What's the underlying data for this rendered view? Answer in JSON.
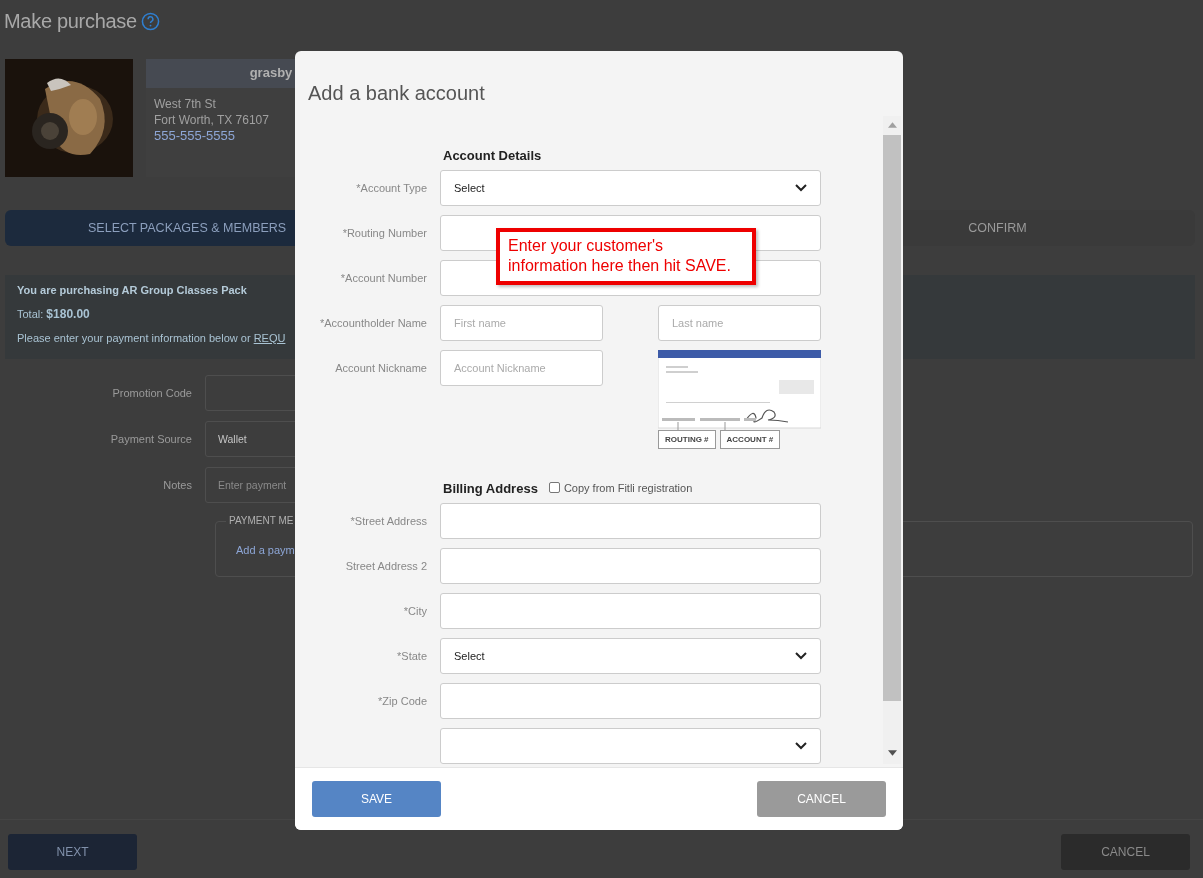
{
  "page": {
    "title": "Make purchase",
    "gym": {
      "name": "grasby",
      "address_line_1": "West 7th St",
      "address_line_2": "Fort Worth, TX 76107",
      "phone": "555-555-5555"
    },
    "steps": [
      {
        "label": "SELECT PACKAGES & MEMBERS",
        "selected": true
      },
      {
        "label": "CONFIRM",
        "selected": false
      }
    ],
    "summary": {
      "message": "You are purchasing AR Group Classes Pack",
      "total_label": "Total:",
      "total": "$180.00",
      "note": "Please enter your payment information below or",
      "link": "REQU"
    },
    "form": [
      {
        "label": "Promotion Code",
        "kind": "input"
      },
      {
        "label": "Payment Source",
        "kind": "select",
        "value": "Wallet"
      },
      {
        "label": "Notes",
        "kind": "input",
        "placeholder": "Enter payment"
      }
    ],
    "payment_methods": {
      "legend": "PAYMENT ME",
      "link": "Add a paym"
    },
    "buttons": [
      {
        "label": "NEXT",
        "kind": "primary"
      },
      {
        "label": "CANCEL",
        "kind": "secondary"
      }
    ]
  },
  "modal": {
    "title": "Add a bank account",
    "sections": [
      {
        "heading": "Account Details",
        "rows": [
          {
            "label": "*Account Type",
            "kind": "select",
            "value": "Select"
          },
          {
            "label": "*Routing Number",
            "kind": "input"
          },
          {
            "label": "*Account Number",
            "kind": "input"
          },
          {
            "label": "*Accountholder Name",
            "kind": "name",
            "placeholders": [
              "First name",
              "Last name"
            ]
          },
          {
            "label": "Account Nickname",
            "kind": "nickname",
            "placeholder": "Account Nickname",
            "check_labels": [
              "ROUTING #",
              "ACCOUNT #"
            ]
          }
        ]
      },
      {
        "heading": "Billing Address",
        "copy_option": {
          "label": "Copy from Fitli registration",
          "checked": false
        },
        "rows": [
          {
            "label": "*Street Address",
            "kind": "input"
          },
          {
            "label": "Street Address 2",
            "kind": "input"
          },
          {
            "label": "*City",
            "kind": "input"
          },
          {
            "label": "*State",
            "kind": "select",
            "value": "Select"
          },
          {
            "label": "*Zip Code",
            "kind": "input"
          },
          {
            "kind": "select"
          }
        ]
      }
    ],
    "callout": "Enter your customer's information here then hit SAVE.",
    "buttons": [
      {
        "label": "SAVE",
        "kind": "primary"
      },
      {
        "label": "CANCEL",
        "kind": "secondary"
      }
    ]
  }
}
